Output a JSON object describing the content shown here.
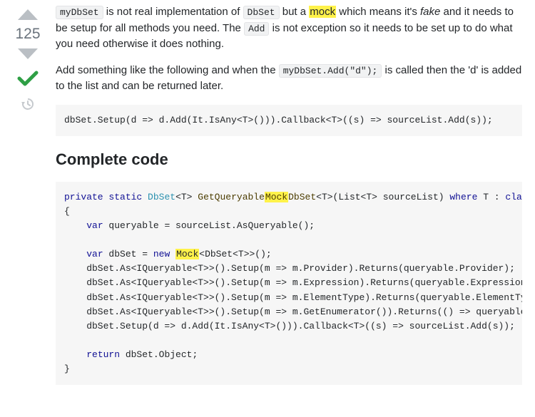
{
  "vote": {
    "score": "125"
  },
  "para1": {
    "code1": "myDbSet",
    "t1": " is not real implementation of ",
    "code2": "DbSet",
    "t2": " but a ",
    "hl1": "mock",
    "t3": " which means it's ",
    "em1": "fake",
    "t4": " and it needs to be setup for all methods you need. The ",
    "code3": "Add",
    "t5": " is not exception so it needs to be set up to do what you need otherwise it does nothing."
  },
  "para2": {
    "t1": "Add something like the following and when the ",
    "code1": "myDbSet.Add(\"d\");",
    "t2": " is called then the 'd' is added to the list and can be returned later."
  },
  "block1": "dbSet.Setup(d => d.Add(It.IsAny<T>())).Callback<T>((s) => sourceList.Add(s));",
  "heading": "Complete code",
  "block2": {
    "kw_private": "private",
    "kw_static": "static",
    "typ_dbset": "DbSet",
    "gen_open": "<T> ",
    "mname_a": "GetQueryable",
    "mname_hl": "Mock",
    "mname_b": "DbSet",
    "sig_rest": "<T>(List<T> sourceList) ",
    "kw_where": "where",
    "where_rest": " T : ",
    "kw_class": "class",
    "brace_open": "{",
    "l_var1a": "    ",
    "kw_var1": "var",
    "l_var1b": " queryable = sourceList.AsQueryable();",
    "l_var2a": "    ",
    "kw_var2": "var",
    "l_var2b": " dbSet = ",
    "kw_new": "new",
    "sp": " ",
    "hl_mock": "Mock",
    "l_var2c": "<DbSet<T>>();",
    "l3": "    dbSet.As<IQueryable<T>>().Setup(m => m.Provider).Returns(queryable.Provider);",
    "l4": "    dbSet.As<IQueryable<T>>().Setup(m => m.Expression).Returns(queryable.Expression);",
    "l5": "    dbSet.As<IQueryable<T>>().Setup(m => m.ElementType).Returns(queryable.ElementType);",
    "l6": "    dbSet.As<IQueryable<T>>().Setup(m => m.GetEnumerator()).Returns(() => queryable.GetEnumerator());",
    "l7": "    dbSet.Setup(d => d.Add(It.IsAny<T>())).Callback<T>((s) => sourceList.Add(s));",
    "l_ret_a": "    ",
    "kw_return": "return",
    "l_ret_b": " dbSet.Object;",
    "brace_close": "}"
  }
}
